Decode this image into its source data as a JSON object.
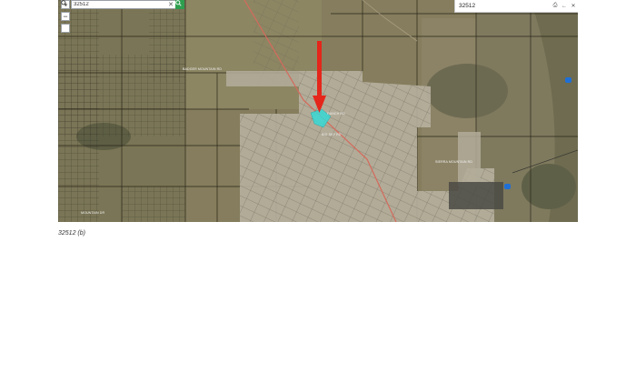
{
  "map": {
    "search": {
      "value": "32512",
      "clear_icon": "close-icon",
      "submit_icon": "search-icon"
    },
    "toolbar": {
      "zoom_in_label": "+",
      "zoom_out_label": "−",
      "icons": [
        "plus-icon",
        "minus-icon",
        "search-zoom-icon"
      ]
    },
    "panel": {
      "title": "32512",
      "icons": [
        "print-icon",
        "back-icon",
        "close-icon"
      ]
    },
    "labels": [
      "BADGER MOUNTAIN RD",
      "RANCH RD",
      "BIG SKY RD",
      "SIERRA MOUNTAIN RD",
      "MOUNTAIN DR"
    ],
    "marker": {
      "type": "arrow",
      "color": "#e5261b"
    },
    "highlight_color": "#38d9d6"
  },
  "caption": "32512 (b)"
}
